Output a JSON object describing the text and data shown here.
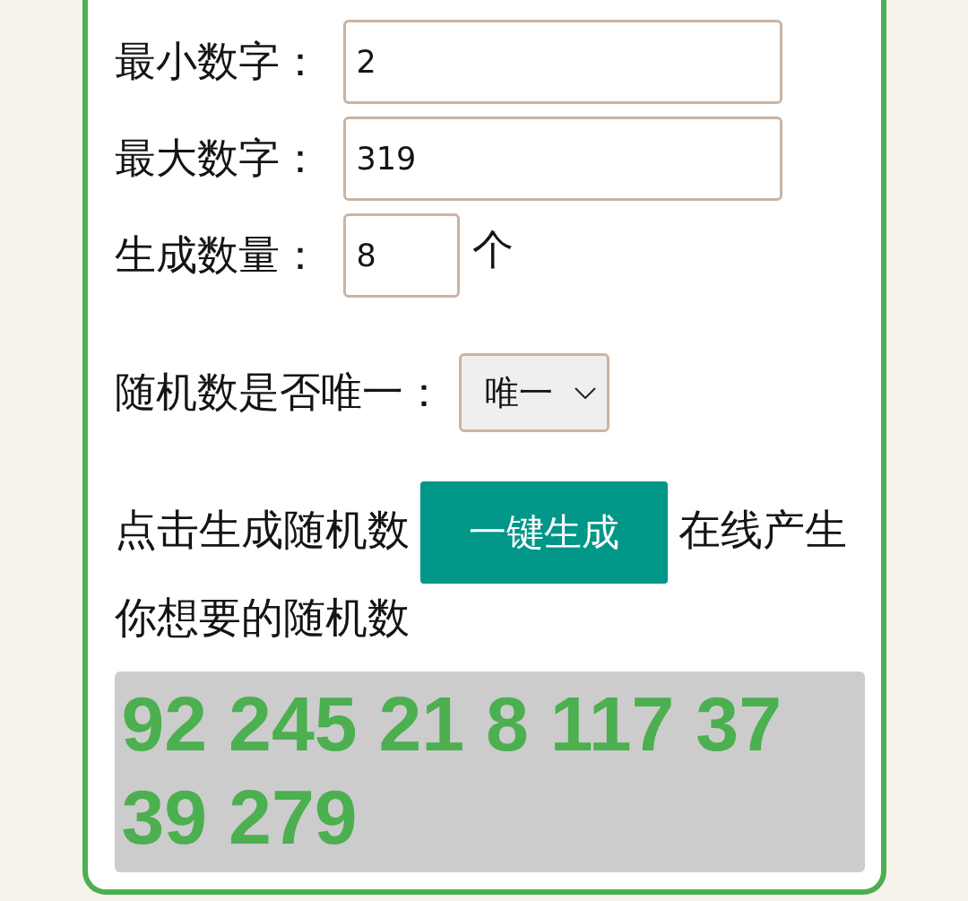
{
  "fields": [
    {
      "kind": "wide",
      "label": "最小数字：",
      "value": "2"
    },
    {
      "kind": "wide",
      "label": "最大数字：",
      "value": "319"
    },
    {
      "kind": "narrow",
      "label": "生成数量：",
      "value": "8",
      "unit": "个"
    }
  ],
  "unique": {
    "label": "随机数是否唯一：",
    "value": "唯一"
  },
  "instruction": {
    "before": "点击生成随机数",
    "button": "一键生成",
    "after": "在线产生你想要的随机数"
  },
  "result": "92 245 21 8 117 37 39 279"
}
